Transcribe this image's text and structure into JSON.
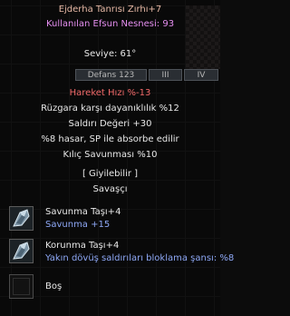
{
  "item": {
    "name": "Ejderha Tanrısı Zırhı+7",
    "enchant_line": "Kullanılan Efsun Nesnesi: 93",
    "level": "Seviye: 61°",
    "tabs": [
      "Defans 123",
      "III",
      "IV"
    ],
    "stats": [
      "Hareket Hızı %-13",
      "Rüzgara karşı dayanıklılık %12",
      "Saldırı Değeri +30",
      "%8 hasar, SP ile absorbe edilir",
      "Kılıç Savunması %10"
    ],
    "wearable": "[ Giyilebilir ]",
    "class": "Savaşçı"
  },
  "sockets": [
    {
      "name": "Savunma Taşı+4",
      "stat": "Savunma +15",
      "icon": "blue-gem-stone-icon"
    },
    {
      "name": "Korunma Taşı+4",
      "stat": "Yakın dövüş saldırıları bloklama şansı: %8",
      "icon": "blue-gem-stone-icon"
    },
    {
      "name": "Boş",
      "stat": "",
      "icon": "empty-socket-icon"
    }
  ],
  "colors": {
    "title": "#e7b9a6",
    "enchant": "#e58ef0",
    "penalty": "#f26a6a",
    "bonus": "#8ea8f6",
    "text": "#e8e8e8"
  }
}
